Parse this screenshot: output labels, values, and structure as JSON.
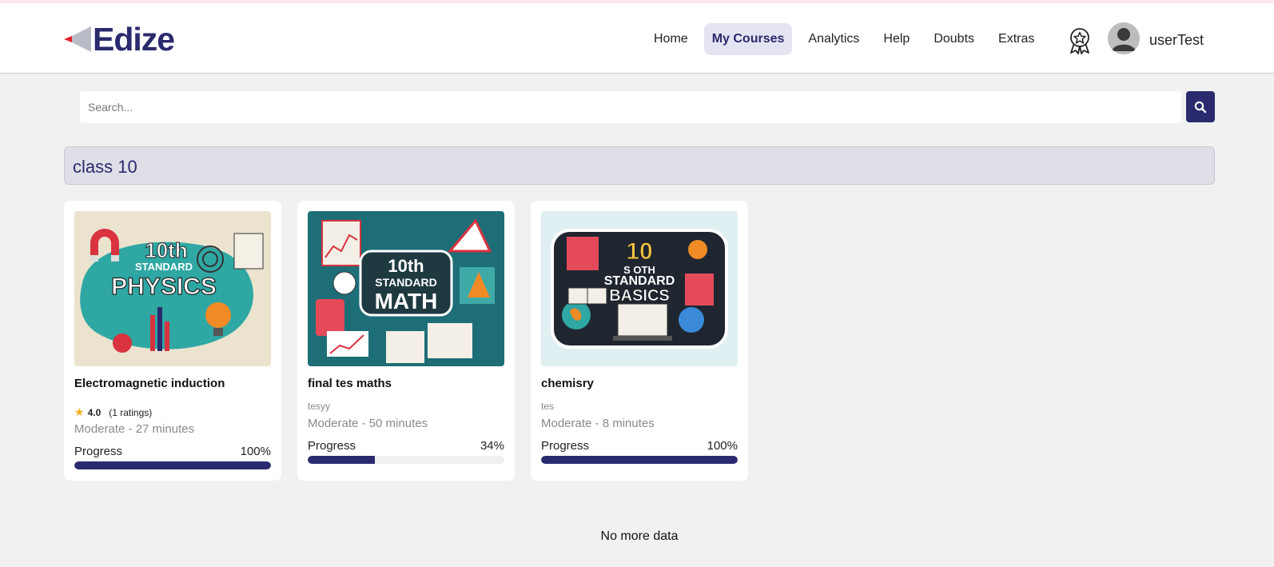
{
  "header": {
    "logo_text": "Edize",
    "nav": [
      {
        "label": "Home",
        "active": false
      },
      {
        "label": "My Courses",
        "active": true
      },
      {
        "label": "Analytics",
        "active": false
      },
      {
        "label": "Help",
        "active": false
      },
      {
        "label": "Doubts",
        "active": false
      },
      {
        "label": "Extras",
        "active": false
      }
    ],
    "achievements_icon": "award-ribbon-icon",
    "username": "userTest"
  },
  "search": {
    "placeholder": "Search...",
    "value": "",
    "button_icon": "search-icon"
  },
  "section": {
    "title": "class 10"
  },
  "courses": [
    {
      "title": "Electromagnetic induction",
      "subtitle": "",
      "rating": "4.0",
      "rating_count": "(1 ratings)",
      "meta": "Moderate - 27 minutes",
      "progress_label": "Progress",
      "progress_text": "100%",
      "progress": 1.0,
      "thumbnail_text": [
        "10th",
        "STANDARD",
        "PHYSICS"
      ]
    },
    {
      "title": "final tes maths",
      "subtitle": "tesyy",
      "meta": "Moderate - 50 minutes",
      "progress_label": "Progress",
      "progress_text": "34%",
      "progress": 0.34,
      "thumbnail_text": [
        "10th",
        "STANDARD",
        "MATH"
      ]
    },
    {
      "title": "chemisry",
      "subtitle": "tes",
      "meta": "Moderate - 8 minutes",
      "progress_label": "Progress",
      "progress_text": "100%",
      "progress": 1.0,
      "thumbnail_text": [
        "10",
        "S OTH",
        "STANDARD",
        "BASICS"
      ]
    }
  ],
  "footer": {
    "no_more": "No more data"
  },
  "colors": {
    "accent": "#2a2a6e",
    "active_nav_bg": "#e4e4f2",
    "star": "#f2b01e"
  }
}
